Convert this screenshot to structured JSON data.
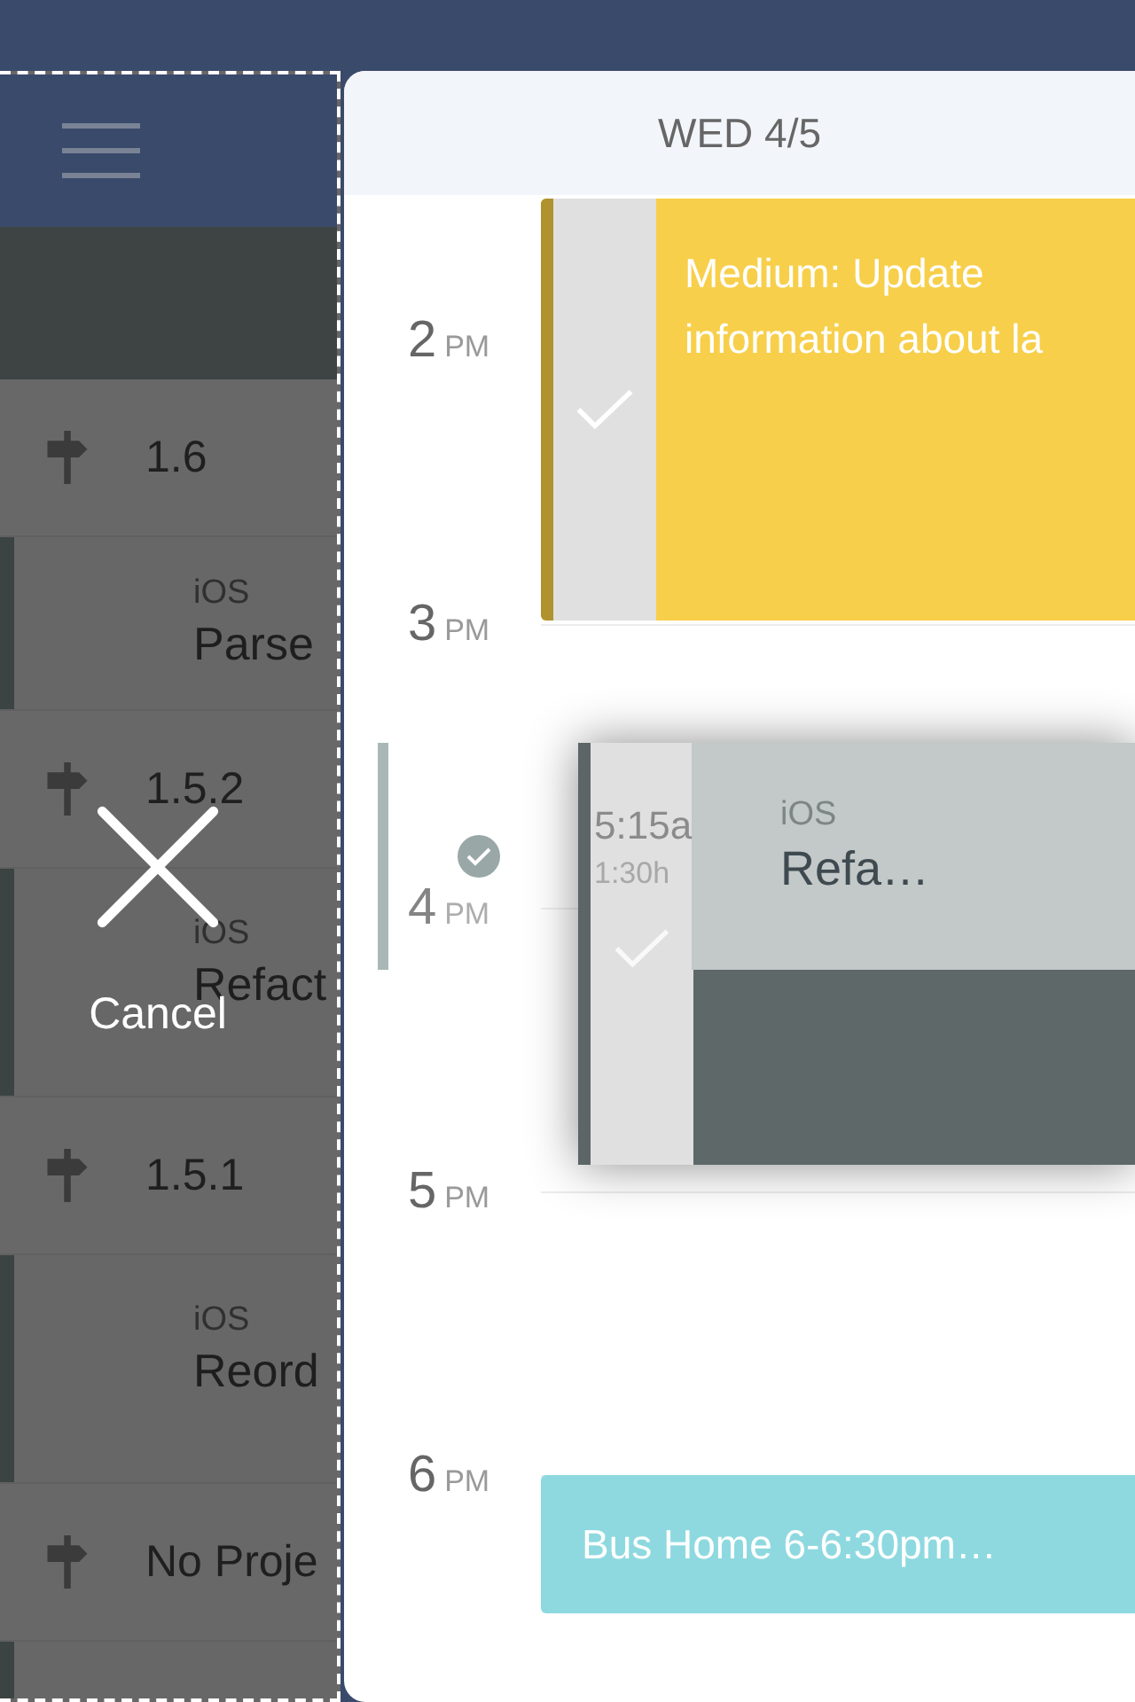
{
  "sidebar": {
    "items": [
      {
        "kind": "milestone",
        "title": "1.6"
      },
      {
        "kind": "task",
        "project": "iOS",
        "title": "Parse"
      },
      {
        "kind": "milestone",
        "title": "1.5.2"
      },
      {
        "kind": "task",
        "project": "iOS",
        "title": "Refact"
      },
      {
        "kind": "milestone",
        "title": "1.5.1"
      },
      {
        "kind": "task",
        "project": "iOS",
        "title": "Reord"
      },
      {
        "kind": "milestone",
        "title": "No Proje"
      }
    ]
  },
  "drag_overlay": {
    "cancel_label": "Cancel"
  },
  "calendar": {
    "day_label": "WED 4/5",
    "hours": [
      {
        "hour": "2",
        "period": "PM"
      },
      {
        "hour": "3",
        "period": "PM"
      },
      {
        "hour": "4",
        "period": "PM"
      },
      {
        "hour": "5",
        "period": "PM"
      },
      {
        "hour": "6",
        "period": "PM"
      }
    ],
    "events": [
      {
        "kind": "task",
        "title": "Medium: Update information about la",
        "color": "#f7cf4a",
        "checked": true
      },
      {
        "kind": "ghost",
        "color": "#a9b7b7",
        "checked": true
      },
      {
        "kind": "dragging",
        "time": "5:15a",
        "duration": "1:30h",
        "project": "iOS",
        "title": "Refa…",
        "color": "#5f6868",
        "checked": true
      },
      {
        "kind": "event",
        "title": "Bus Home 6-6:30pm…",
        "color": "#8ed9e0"
      }
    ]
  }
}
